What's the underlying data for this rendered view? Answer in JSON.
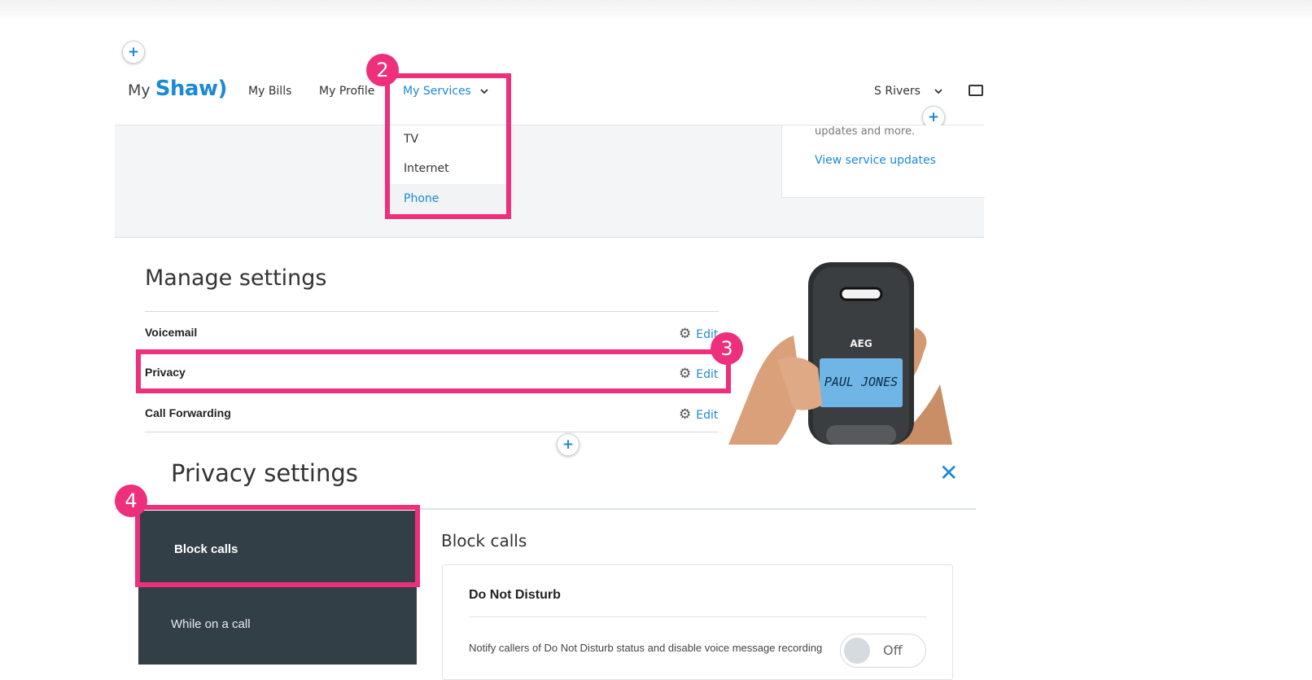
{
  "brand": {
    "my": "My",
    "name": "Shaw)"
  },
  "nav": {
    "links": [
      "My Bills",
      "My Profile",
      "My Services"
    ],
    "user": "S Rivers",
    "user_caret": "⌄"
  },
  "dropdown": {
    "items": [
      "TV",
      "Internet",
      "Phone"
    ],
    "selected": "Phone"
  },
  "updates": {
    "text": "updates and more.",
    "link": "View service updates"
  },
  "badges": [
    "2",
    "3",
    "4"
  ],
  "manage": {
    "title": "Manage settings",
    "rows": [
      {
        "label": "Voicemail",
        "action": "Edit"
      },
      {
        "label": "Privacy",
        "action": "Edit"
      },
      {
        "label": "Call Forwarding",
        "action": "Edit"
      }
    ]
  },
  "phone_image": {
    "brand": "AEG",
    "screen": "PAUL JONES"
  },
  "privacy": {
    "title": "Privacy settings",
    "close": "✕",
    "tabs": [
      "Block calls",
      "While on a call"
    ],
    "section_title": "Block calls",
    "card": {
      "title": "Do Not Disturb",
      "description": "Notify callers of Do Not Disturb status and disable voice message recording",
      "toggle": "Off"
    }
  },
  "colors": {
    "accent": "#1a8ad4",
    "highlight": "#ee2f7c",
    "sidebar": "#333f47"
  }
}
